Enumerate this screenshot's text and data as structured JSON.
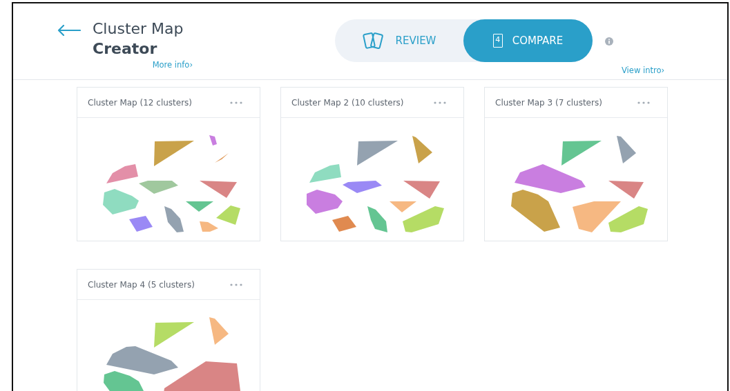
{
  "header": {
    "title_line_1": "Cluster Map",
    "title_line_2": "Creator",
    "more_info_link": "More info›",
    "view_intro_link": "View intro›"
  },
  "mode_toggle": [
    {
      "kind": "review",
      "label": "REVIEW",
      "selected": false
    },
    {
      "kind": "compare",
      "label": "COMPARE",
      "badge": "4",
      "selected": true
    }
  ],
  "cards": [
    {
      "title": "Cluster Map (12 clusters)"
    },
    {
      "title": "Cluster Map 2 (10 clusters)"
    },
    {
      "title": "Cluster Map 3 (7 clusters)"
    },
    {
      "title": "Cluster Map 4 (5 clusters)"
    }
  ]
}
